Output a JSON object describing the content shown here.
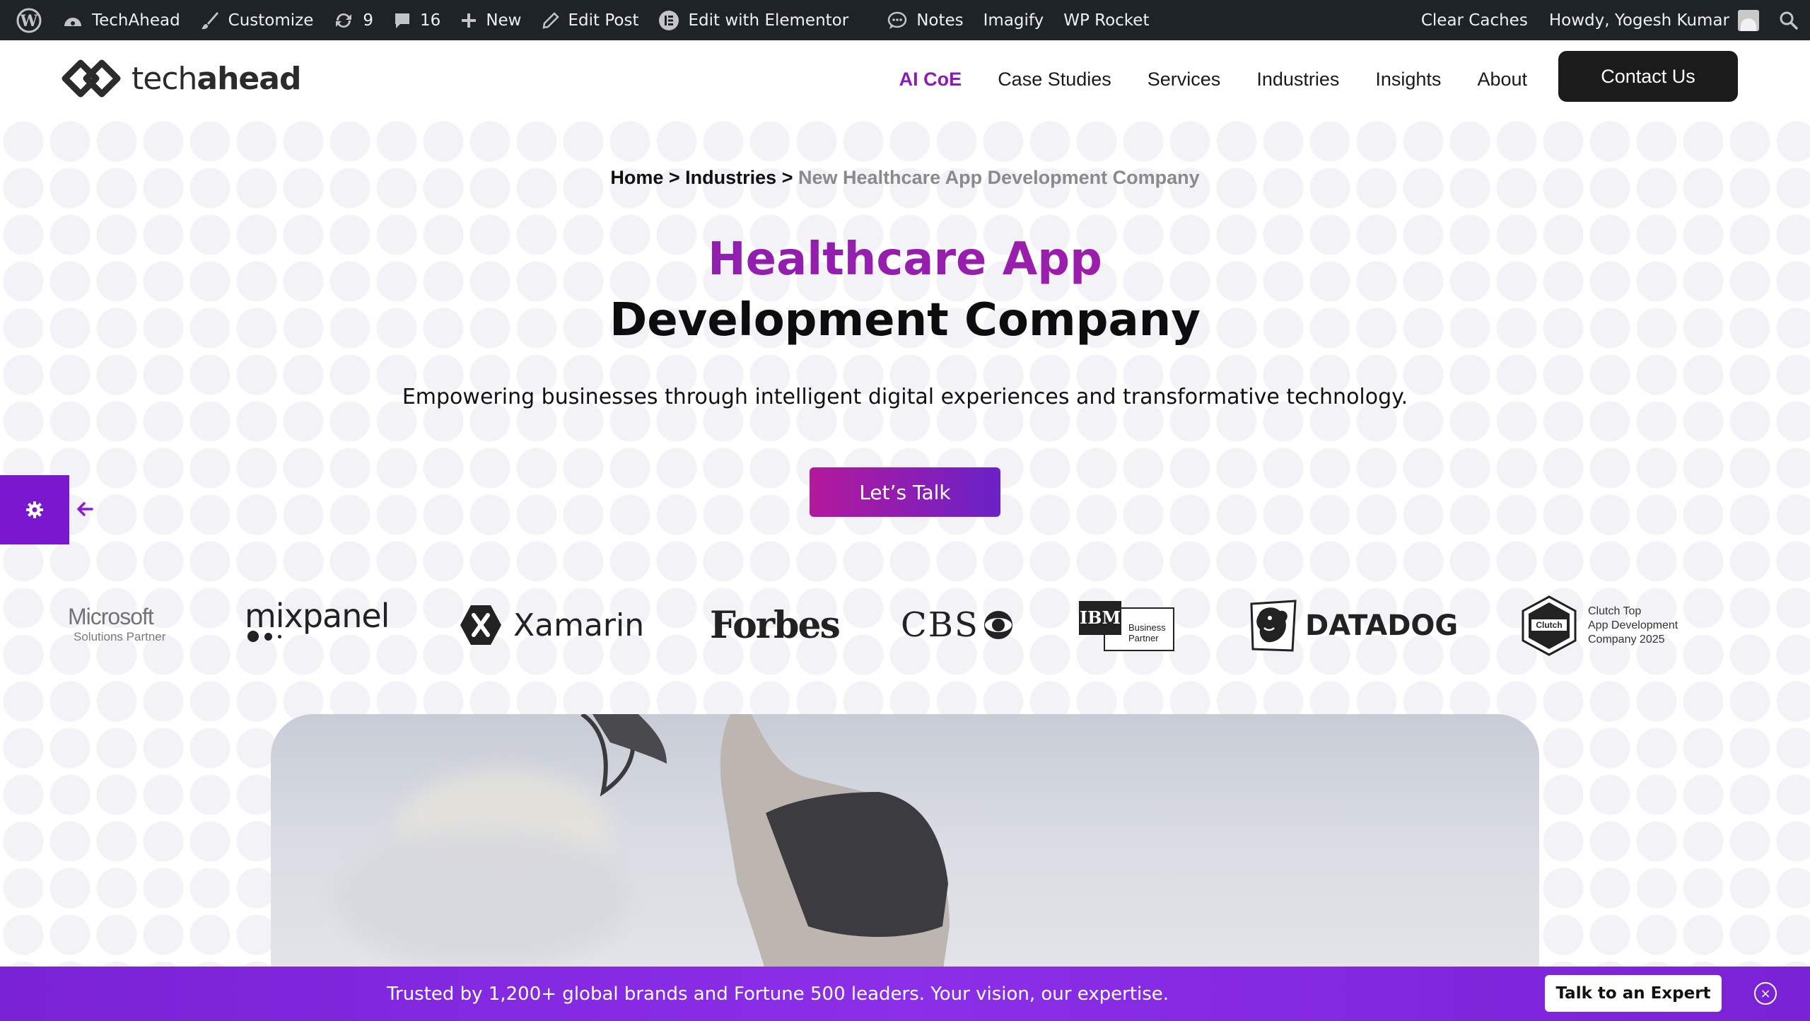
{
  "admin_bar": {
    "site_name": "TechAhead",
    "customize": "Customize",
    "updates_count": "9",
    "comments_count": "16",
    "new": "New",
    "edit_post": "Edit Post",
    "edit_elementor": "Edit with Elementor",
    "notes": "Notes",
    "imagify": "Imagify",
    "wp_rocket": "WP Rocket",
    "clear_caches": "Clear Caches",
    "howdy": "Howdy, Yogesh Kumar"
  },
  "header": {
    "logo_light": "tech",
    "logo_bold": "ahead",
    "nav": [
      "AI CoE",
      "Case Studies",
      "Services",
      "Industries",
      "Insights",
      "About"
    ],
    "contact_label": "Contact Us",
    "active_color": "#8a1ab9"
  },
  "breadcrumb": {
    "home": "Home",
    "sep": ">",
    "industries": "Industries",
    "current": "New Healthcare App Development Company"
  },
  "hero": {
    "title_line1": "Healthcare App",
    "title_line2": "Development Company",
    "subtitle": "Empowering businesses through intelligent digital experiences and transformative technology.",
    "cta_label": "Let’s Talk"
  },
  "logos": {
    "microsoft": "Microsoft",
    "microsoft_sub": "Solutions Partner",
    "mixpanel": "mixpanel",
    "xamarin": "Xamarin",
    "forbes": "Forbes",
    "cbs": "CBS",
    "ibm": "IBM",
    "ibm_sub1": "Business",
    "ibm_sub2": "Partner",
    "datadog": "DATADOG",
    "clutch_badge": "Clutch",
    "clutch_line1": "Clutch Top",
    "clutch_line2": "App Development",
    "clutch_line3": "Company 2025"
  },
  "bottom_bar": {
    "text": "Trusted by 1,200+ global brands and Fortune 500 leaders. Your vision, our expertise.",
    "button_label": "Talk to an Expert"
  }
}
